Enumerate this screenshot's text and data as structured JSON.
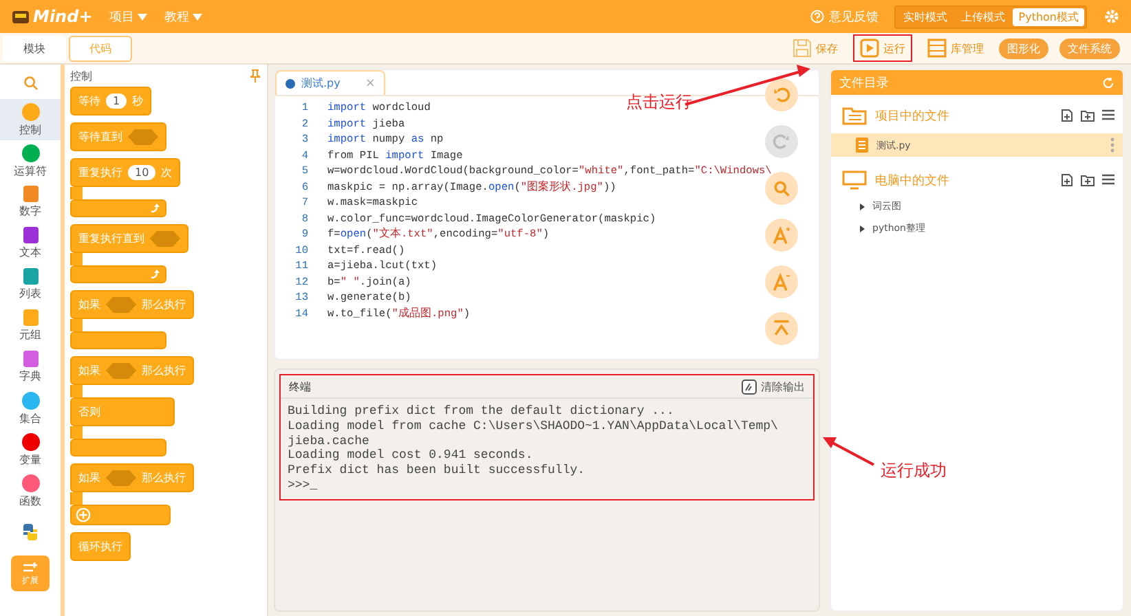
{
  "header": {
    "logo": "Mind+",
    "menus": [
      {
        "label": "项目"
      },
      {
        "label": "教程"
      }
    ],
    "feedback": "意见反馈",
    "modes": [
      {
        "label": "实时模式",
        "selected": false
      },
      {
        "label": "上传模式",
        "selected": false
      },
      {
        "label": "Python模式",
        "selected": true
      }
    ]
  },
  "view_tabs": [
    {
      "label": "模块",
      "selected": false
    },
    {
      "label": "代码",
      "selected": true
    }
  ],
  "toolbar": [
    {
      "kind": "save",
      "label": "保存",
      "highlighted": false
    },
    {
      "kind": "run",
      "label": "运行",
      "highlighted": true
    },
    {
      "kind": "library",
      "label": "库管理",
      "highlighted": false
    },
    {
      "kind": "pill",
      "label": "图形化",
      "highlighted": false
    },
    {
      "kind": "pill",
      "label": "文件系统",
      "highlighted": false
    }
  ],
  "categories": [
    {
      "kind": "dot",
      "label": "控制",
      "color": "#ffab19",
      "selected": true
    },
    {
      "kind": "dot",
      "label": "运算符",
      "color": "#00b050",
      "selected": false
    },
    {
      "kind": "square",
      "label": "数字",
      "color": "#f08a24",
      "selected": false
    },
    {
      "kind": "square",
      "label": "文本",
      "color": "#9b30d9",
      "selected": false
    },
    {
      "kind": "square",
      "label": "列表",
      "color": "#1aa5a5",
      "selected": false
    },
    {
      "kind": "square",
      "label": "元组",
      "color": "#ffab19",
      "selected": false
    },
    {
      "kind": "square",
      "label": "字典",
      "color": "#d45ee0",
      "selected": false
    },
    {
      "kind": "dot",
      "label": "集合",
      "color": "#2ab7f0",
      "selected": false
    },
    {
      "kind": "dot",
      "label": "变量",
      "color": "#ee0000",
      "selected": false
    },
    {
      "kind": "dot",
      "label": "函数",
      "color": "#ff5a7a",
      "selected": false
    },
    {
      "kind": "python",
      "selected": false
    }
  ],
  "extension_button": "扩展",
  "palette": {
    "title": "控制",
    "blocks": [
      {
        "kind": "simple",
        "label": "等待",
        "input": "1",
        "suffix": "秒"
      },
      {
        "kind": "simple",
        "label": "等待直到",
        "hex": true
      },
      {
        "kind": "loop",
        "label": "重复执行",
        "input": "10",
        "suffix": "次"
      },
      {
        "kind": "loop",
        "label": "重复执行直到",
        "hex": true
      },
      {
        "kind": "if",
        "label": "如果",
        "hex": true,
        "suffix": "那么执行"
      },
      {
        "kind": "ifelse",
        "label": "如果",
        "hex": true,
        "suffix": "那么执行",
        "else_label": "否则"
      },
      {
        "kind": "ifplus",
        "label": "如果",
        "hex": true,
        "suffix": "那么执行"
      },
      {
        "kind": "simple",
        "label": "循环执行"
      }
    ]
  },
  "editor": {
    "tab": "测试.py",
    "close": "×",
    "lines": [
      {
        "number": "1",
        "segments": [
          {
            "kind": "keyword",
            "text": "import"
          },
          {
            "kind": "plain",
            "text": " wordcloud"
          }
        ]
      },
      {
        "number": "2",
        "segments": [
          {
            "kind": "keyword",
            "text": "import"
          },
          {
            "kind": "plain",
            "text": " jieba"
          }
        ]
      },
      {
        "number": "3",
        "segments": [
          {
            "kind": "keyword",
            "text": "import"
          },
          {
            "kind": "plain",
            "text": " numpy "
          },
          {
            "kind": "keyword",
            "text": "as"
          },
          {
            "kind": "plain",
            "text": " np"
          }
        ]
      },
      {
        "number": "4",
        "segments": [
          {
            "kind": "plain",
            "text": "from PIL "
          },
          {
            "kind": "keyword",
            "text": "import"
          },
          {
            "kind": "plain",
            "text": " Image"
          }
        ]
      },
      {
        "number": "5",
        "segments": [
          {
            "kind": "plain",
            "text": "w=wordcloud.WordCloud(background_color="
          },
          {
            "kind": "string",
            "text": "\"white\""
          },
          {
            "kind": "plain",
            "text": ",font_path="
          },
          {
            "kind": "string",
            "text": "\"C:\\Windows\\"
          }
        ]
      },
      {
        "number": "6",
        "segments": [
          {
            "kind": "plain",
            "text": "maskpic = np.array(Image."
          },
          {
            "kind": "keyword",
            "text": "open"
          },
          {
            "kind": "plain",
            "text": "("
          },
          {
            "kind": "string",
            "text": "\"图案形状.jpg\""
          },
          {
            "kind": "plain",
            "text": "))"
          }
        ]
      },
      {
        "number": "7",
        "segments": [
          {
            "kind": "plain",
            "text": "w.mask=maskpic"
          }
        ]
      },
      {
        "number": "8",
        "segments": [
          {
            "kind": "plain",
            "text": "w.color_func=wordcloud.ImageColorGenerator(maskpic)"
          }
        ]
      },
      {
        "number": "9",
        "segments": [
          {
            "kind": "plain",
            "text": "f="
          },
          {
            "kind": "keyword",
            "text": "open"
          },
          {
            "kind": "plain",
            "text": "("
          },
          {
            "kind": "string",
            "text": "\"文本.txt\""
          },
          {
            "kind": "plain",
            "text": ",encoding="
          },
          {
            "kind": "string",
            "text": "\"utf-8\""
          },
          {
            "kind": "plain",
            "text": ")"
          }
        ]
      },
      {
        "number": "10",
        "segments": [
          {
            "kind": "plain",
            "text": "txt=f.read()"
          }
        ]
      },
      {
        "number": "11",
        "segments": [
          {
            "kind": "plain",
            "text": "a=jieba.lcut(txt)"
          }
        ]
      },
      {
        "number": "12",
        "segments": [
          {
            "kind": "plain",
            "text": "b="
          },
          {
            "kind": "string",
            "text": "\" \""
          },
          {
            "kind": "plain",
            "text": ".join(a)"
          }
        ]
      },
      {
        "number": "13",
        "segments": [
          {
            "kind": "plain",
            "text": "w.generate(b)"
          }
        ]
      },
      {
        "number": "14",
        "segments": [
          {
            "kind": "plain",
            "text": "w.to_file("
          },
          {
            "kind": "string",
            "text": "\"成品图.png\""
          },
          {
            "kind": "plain",
            "text": ")"
          }
        ]
      }
    ],
    "side_buttons": [
      {
        "kind": "undo",
        "disabled": false
      },
      {
        "kind": "redo",
        "disabled": true
      },
      {
        "kind": "search",
        "disabled": false
      },
      {
        "kind": "font_up",
        "disabled": false
      },
      {
        "kind": "font_down",
        "disabled": false
      },
      {
        "kind": "top",
        "disabled": false
      }
    ]
  },
  "terminal": {
    "title": "终端",
    "clear_button": "清除输出",
    "highlighted": true,
    "output": [
      "Building prefix dict from the default dictionary ...",
      "Loading model from cache C:\\Users\\SHAODO~1.YAN\\AppData\\Local\\Temp\\",
      "jieba.cache",
      "Loading model cost 0.941 seconds.",
      "Prefix dict has been built successfully.",
      ">>>_"
    ]
  },
  "file_panel": {
    "title": "文件目录",
    "sections": [
      {
        "kind": "project",
        "title": "项目中的文件",
        "files": [
          {
            "name": "测试.py",
            "selected": true
          }
        ]
      },
      {
        "kind": "computer",
        "title": "电脑中的文件",
        "folders": [
          {
            "name": "词云图",
            "expanded": false
          },
          {
            "name": "python整理",
            "expanded": false
          }
        ]
      }
    ]
  },
  "annotations": [
    {
      "text": "点击运行"
    },
    {
      "text": "运行成功"
    }
  ]
}
